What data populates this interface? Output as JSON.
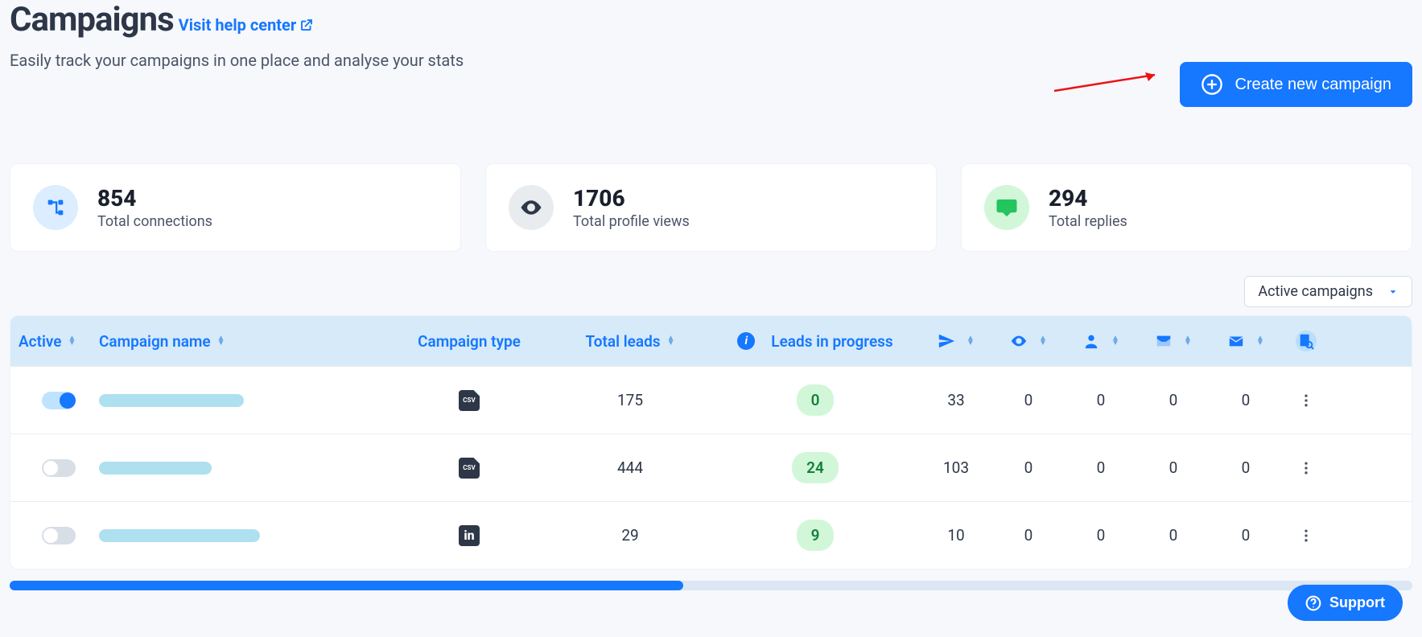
{
  "header": {
    "title": "Campaigns",
    "help_link": "Visit help center",
    "subtitle": "Easily track your campaigns in one place and analyse your stats",
    "create_button": "Create new campaign"
  },
  "stats": {
    "connections": {
      "value": "854",
      "label": "Total connections"
    },
    "views": {
      "value": "1706",
      "label": "Total profile views"
    },
    "replies": {
      "value": "294",
      "label": "Total replies"
    }
  },
  "filter": {
    "selected": "Active campaigns"
  },
  "table": {
    "headers": {
      "active": "Active",
      "name": "Campaign name",
      "type": "Campaign type",
      "leads": "Total leads",
      "progress": "Leads in progress"
    },
    "rows": [
      {
        "active": true,
        "name": "",
        "type": "csv",
        "leads": "175",
        "progress": "0",
        "m1": "33",
        "m2": "0",
        "m3": "0",
        "m4": "0",
        "m5": "0"
      },
      {
        "active": false,
        "name": "",
        "type": "csv",
        "leads": "444",
        "progress": "24",
        "m1": "103",
        "m2": "0",
        "m3": "0",
        "m4": "0",
        "m5": "0"
      },
      {
        "active": false,
        "name": "",
        "type": "linkedin",
        "leads": "29",
        "progress": "9",
        "m1": "10",
        "m2": "0",
        "m3": "0",
        "m4": "0",
        "m5": "0"
      }
    ]
  },
  "support_label": "Support"
}
